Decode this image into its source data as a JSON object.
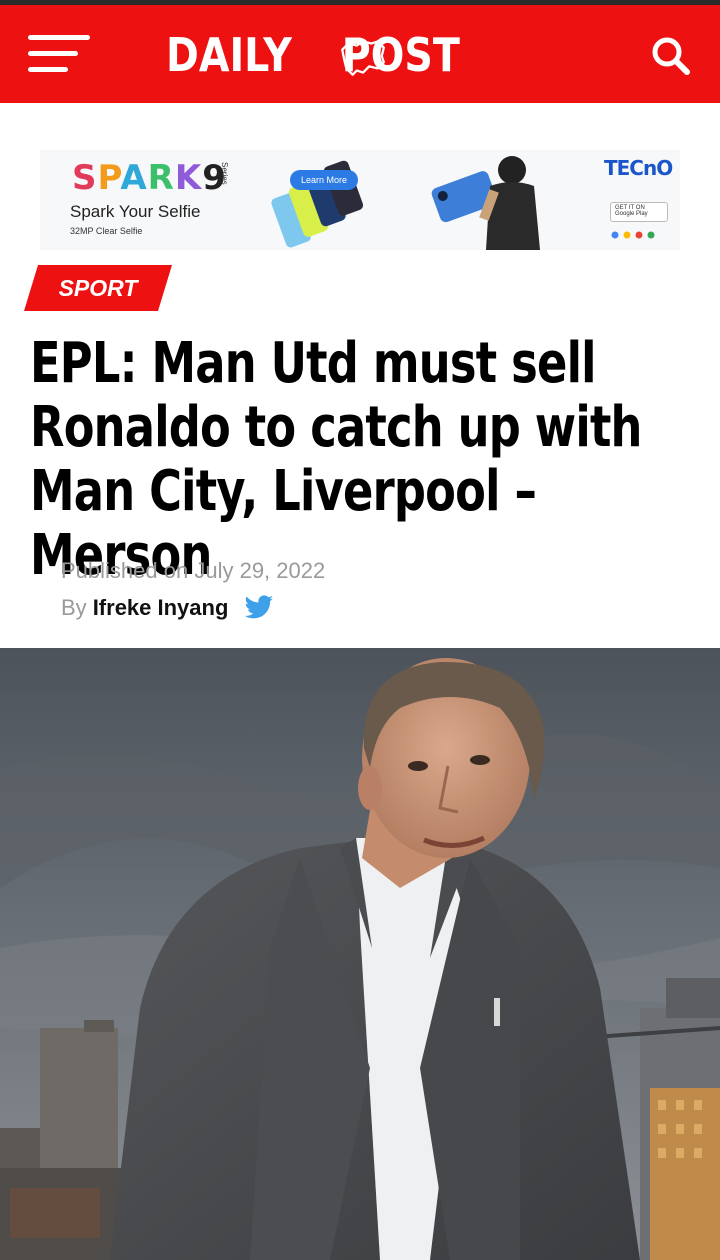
{
  "header": {
    "logo_left": "DAILY",
    "logo_right": "POST",
    "background": "#ee1111",
    "menu_icon": "hamburger-menu-icon",
    "search_icon": "search-icon"
  },
  "ad": {
    "brand": [
      "S",
      "P",
      "A",
      "R",
      "K"
    ],
    "brand_number": "9",
    "series": "Series",
    "tagline": "Spark Your Selfie",
    "sub": "32MP Clear Selfie",
    "learn_more": "Learn More",
    "right_brand": "TECnO",
    "play_badge": "GET IT ON Google Play"
  },
  "article": {
    "category": "SPORT",
    "category_color": "#ee1111",
    "title_lines": [
      "EPL: Man Utd must sell",
      "Ronaldo to catch up with",
      "Man City, Liverpool – Merson"
    ],
    "published_label": "Published on",
    "published_date": "July 29, 2022",
    "by_label": "By",
    "author": "Ifreke Inyang",
    "social_icon": "twitter-icon"
  },
  "hero_image": {
    "description_icon": "hero-photo"
  }
}
